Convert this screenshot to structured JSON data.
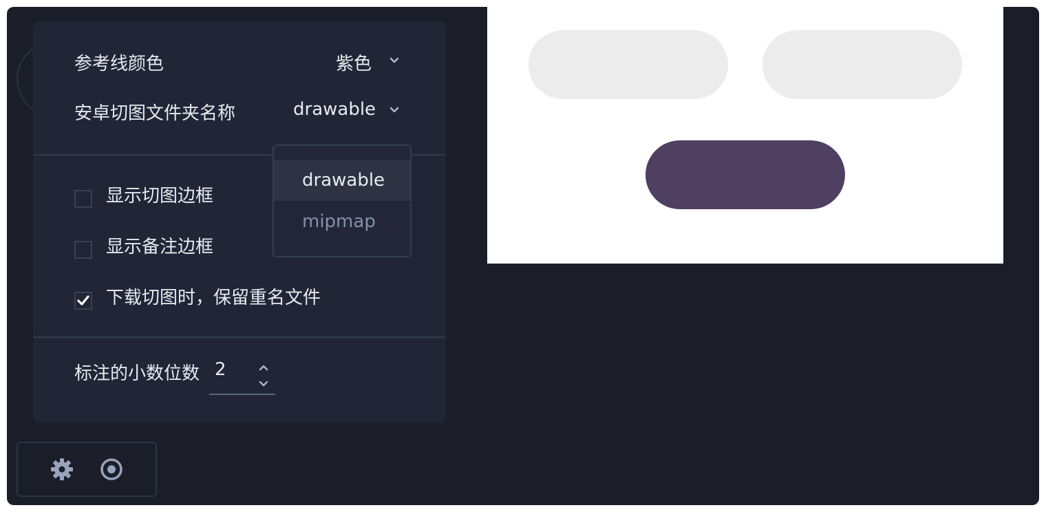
{
  "settings": {
    "guide_color": {
      "label": "参考线颜色",
      "value": "紫色"
    },
    "android_folder": {
      "label": "安卓切图文件夹名称",
      "value": "drawable"
    },
    "checkboxes": [
      {
        "label": "显示切图边框",
        "checked": false
      },
      {
        "label": "显示备注边框",
        "checked": false
      },
      {
        "label": "下载切图时，保留重名文件",
        "checked": true
      }
    ],
    "decimal_places": {
      "label": "标注的小数位数",
      "value": "2"
    }
  },
  "dropdown": {
    "options": [
      {
        "label": "drawable",
        "selected": true
      },
      {
        "label": "mipmap",
        "selected": false
      }
    ]
  },
  "toolbar": {
    "icons": [
      "gear-icon",
      "eye-icon"
    ]
  },
  "colors": {
    "background": "#1b1e28",
    "panel": "#212535",
    "preview_pill_purple": "#4f3f61",
    "preview_pill_grey": "#ececec",
    "muted_text": "#8590ad"
  }
}
